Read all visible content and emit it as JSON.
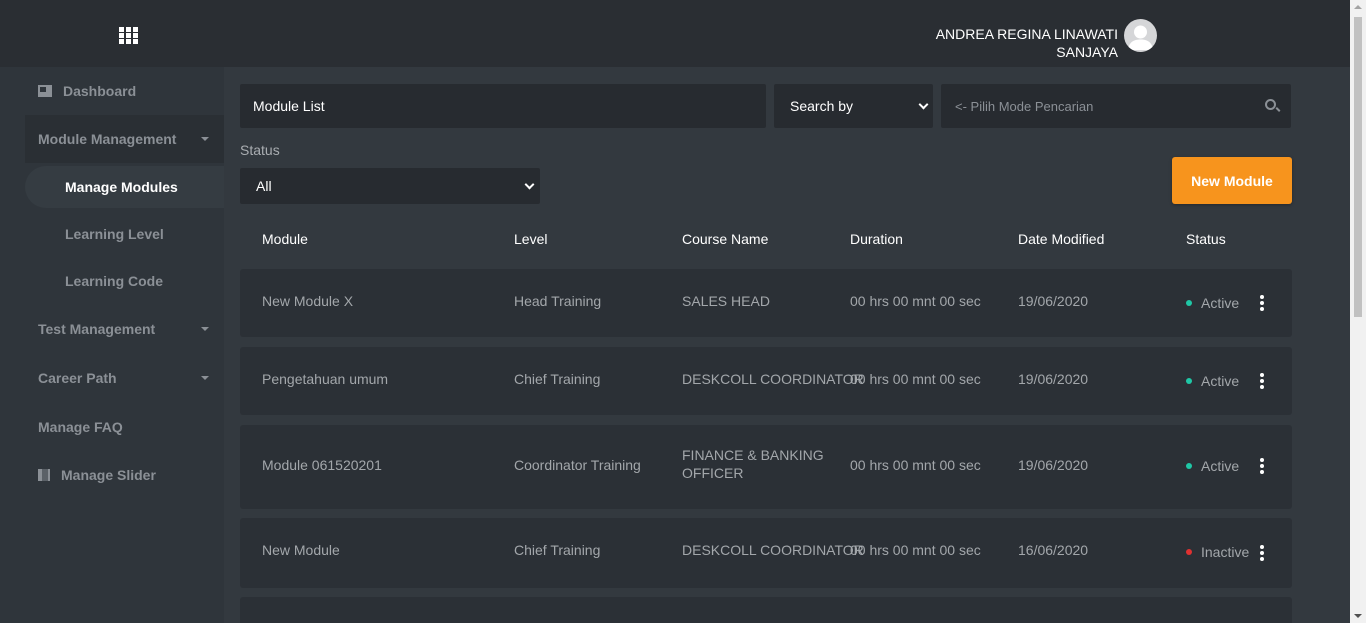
{
  "header": {
    "user_name_line1": "ANDREA REGINA LINAWATI",
    "user_name_line2": "SANJAYA"
  },
  "sidebar": {
    "items": [
      {
        "label": "Dashboard",
        "icon": "dashboard-icon"
      },
      {
        "label": "Module Management",
        "icon": "caret-down-icon"
      },
      {
        "label": "Manage Modules"
      },
      {
        "label": "Learning Level"
      },
      {
        "label": "Learning Code"
      },
      {
        "label": "Test Management",
        "icon": "caret-down-icon"
      },
      {
        "label": "Career Path",
        "icon": "caret-down-icon"
      },
      {
        "label": "Manage FAQ"
      },
      {
        "label": "Manage Slider",
        "icon": "slider-icon"
      }
    ]
  },
  "toolbar": {
    "title": "Module List",
    "search_by": "Search by",
    "search_placeholder": "<- Pilih Mode Pencarian",
    "status_label": "Status",
    "status_value": "All",
    "new_button": "New Module"
  },
  "table": {
    "columns": [
      "Module",
      "Level",
      "Course Name",
      "Duration",
      "Date Modified",
      "Status"
    ],
    "rows": [
      {
        "module": "New Module X",
        "level": "Head Training",
        "course": "SALES HEAD",
        "duration": "00 hrs 00 mnt 00 sec",
        "date": "19/06/2020",
        "status": "Active"
      },
      {
        "module": "Pengetahuan umum",
        "level": "Chief Training",
        "course": "DESKCOLL COORDINATOR",
        "duration": "00 hrs 00 mnt 00 sec",
        "date": "19/06/2020",
        "status": "Active"
      },
      {
        "module": "Module 061520201",
        "level": "Coordinator Training",
        "course_line1": "FINANCE & BANKING",
        "course_line2": "OFFICER",
        "duration": "00 hrs 00 mnt 00 sec",
        "date": "19/06/2020",
        "status": "Active"
      },
      {
        "module": "New Module",
        "level": "Chief Training",
        "course": "DESKCOLL COORDINATOR",
        "duration": "00 hrs 00 mnt 00 sec",
        "date": "16/06/2020",
        "status": "Inactive"
      }
    ]
  },
  "colors": {
    "accent": "#f7941d",
    "active": "#1fc7a6",
    "inactive": "#e03131"
  }
}
